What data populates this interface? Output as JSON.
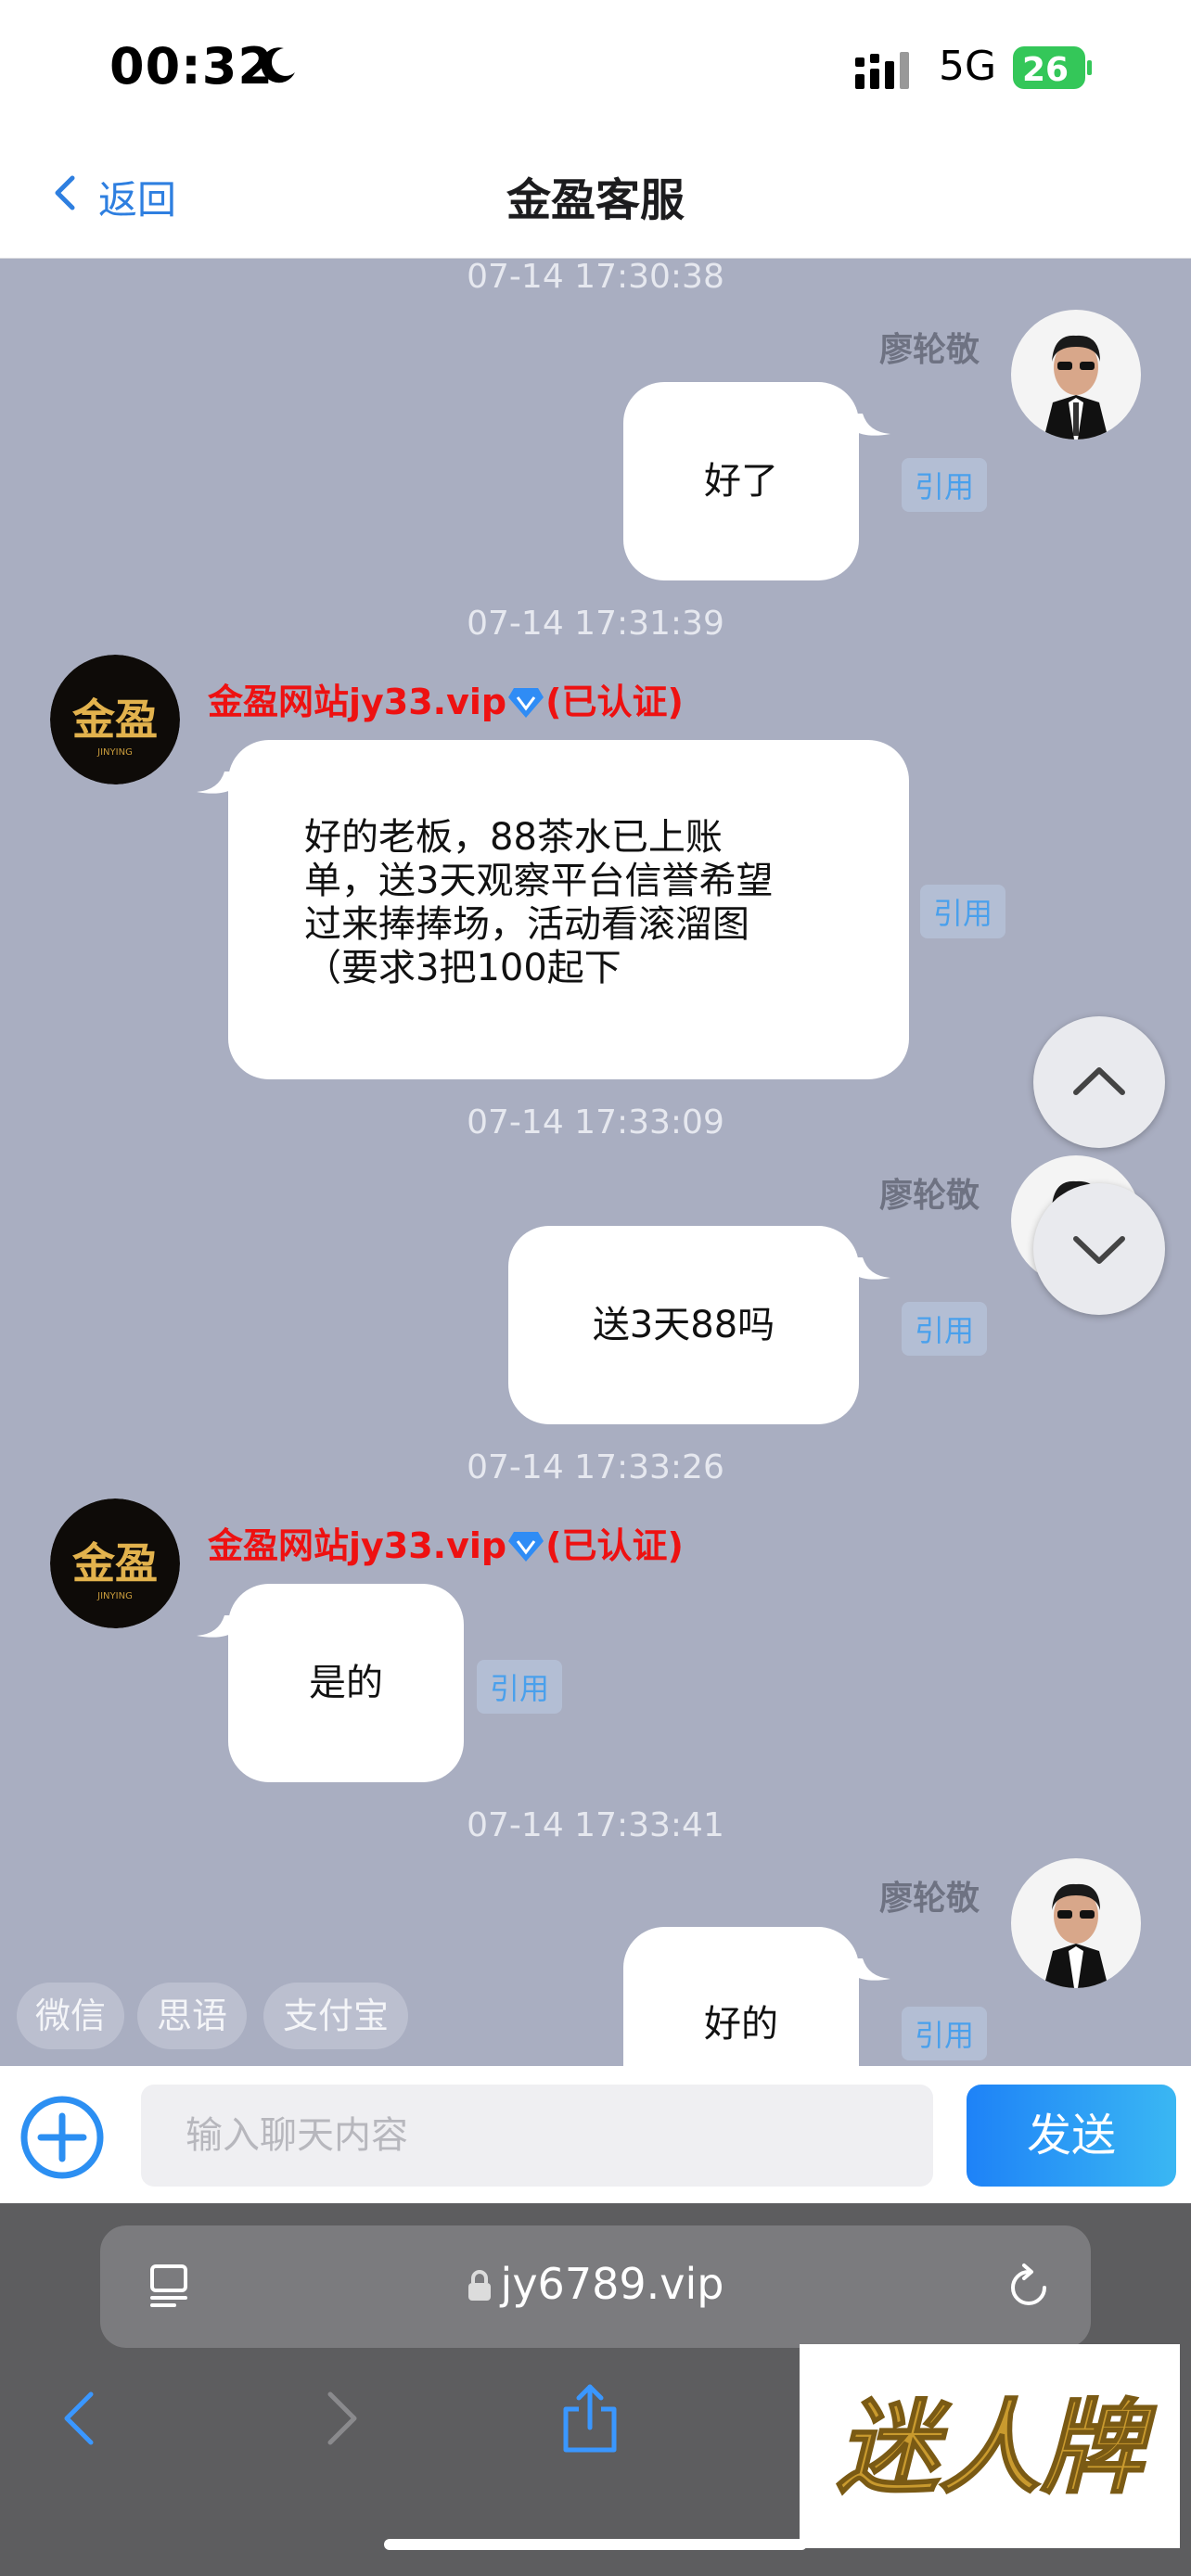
{
  "status_bar": {
    "time": "00:32",
    "network": "5G",
    "battery": "26"
  },
  "nav": {
    "back_label": "返回",
    "title": "金盈客服"
  },
  "chat": {
    "messages": [
      {
        "timestamp": "07-14 17:30:38",
        "sender": "廖轮敬",
        "text": "好了",
        "quote_label": "引用"
      },
      {
        "timestamp": "07-14 17:31:39",
        "sender": "金盈网站jy33.vip",
        "verified": "(已认证)",
        "lines": [
          "好的老板，88茶水已上账",
          "单，送3天观察平台信誉希望",
          "过来捧捧场，活动看滚溜图",
          "（要求3把100起下"
        ],
        "quote_label": "引用"
      },
      {
        "timestamp": "07-14 17:33:09",
        "sender": "廖轮敬",
        "text": "送3天88吗",
        "quote_label": "引用"
      },
      {
        "timestamp": "07-14 17:33:26",
        "sender": "金盈网站jy33.vip",
        "verified": "(已认证)",
        "text": "是的",
        "quote_label": "引用"
      },
      {
        "timestamp": "07-14 17:33:41",
        "sender": "廖轮敬",
        "text": "好的",
        "quote_label": "引用"
      }
    ],
    "logo_text": "金盈",
    "logo_sub": "JINYING"
  },
  "quick_replies": [
    "微信",
    "思语",
    "支付宝"
  ],
  "input": {
    "placeholder": "输入聊天内容",
    "send_label": "发送"
  },
  "browser": {
    "url": "jy6789.vip"
  },
  "watermark": {
    "text": "迷人牌"
  },
  "colors": {
    "chat_bg": "#a9aec1",
    "accent": "#2e7fe0",
    "sender_official": "#ee1111",
    "send_button": "#1e82f7"
  }
}
